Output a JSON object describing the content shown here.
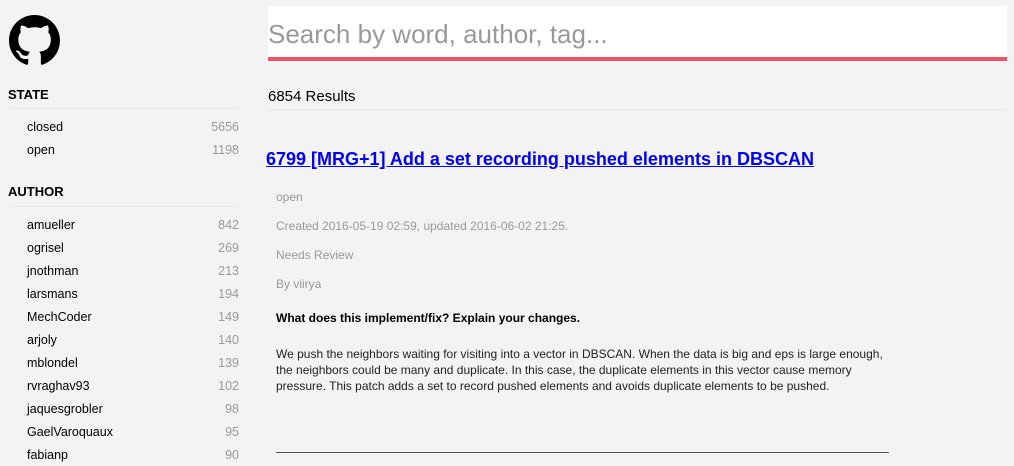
{
  "sidebar": {
    "state_heading": "STATE",
    "state": [
      {
        "label": "closed",
        "count": "5656"
      },
      {
        "label": "open",
        "count": "1198"
      }
    ],
    "author_heading": "AUTHOR",
    "authors": [
      {
        "label": "amueller",
        "count": "842"
      },
      {
        "label": "ogrisel",
        "count": "269"
      },
      {
        "label": "jnothman",
        "count": "213"
      },
      {
        "label": "larsmans",
        "count": "194"
      },
      {
        "label": "MechCoder",
        "count": "149"
      },
      {
        "label": "arjoly",
        "count": "140"
      },
      {
        "label": "mblondel",
        "count": "139"
      },
      {
        "label": "rvraghav93",
        "count": "102"
      },
      {
        "label": "jaquesgrobler",
        "count": "98"
      },
      {
        "label": "GaelVaroquaux",
        "count": "95"
      },
      {
        "label": "fabianp",
        "count": "90"
      }
    ]
  },
  "search": {
    "placeholder": "Search by word, author, tag...",
    "value": "",
    "accent": "#ec5365"
  },
  "results_count": "6854 Results",
  "result": {
    "title": "6799 [MRG+1] Add a set recording pushed elements in DBSCAN",
    "state": "open",
    "dates": "Created 2016-05-19 02:59, updated 2016-06-02 21:25.",
    "label": "Needs Review",
    "author": "By viirya",
    "question": "What does this implement/fix? Explain your changes.",
    "body": "We push the neighbors waiting for visiting into a vector in DBSCAN. When the data is big and eps is large enough, the neighbors could be many and duplicate. In this case, the duplicate elements in this vector cause memory pressure. This patch adds a set to record pushed elements and avoids duplicate elements to be pushed."
  }
}
